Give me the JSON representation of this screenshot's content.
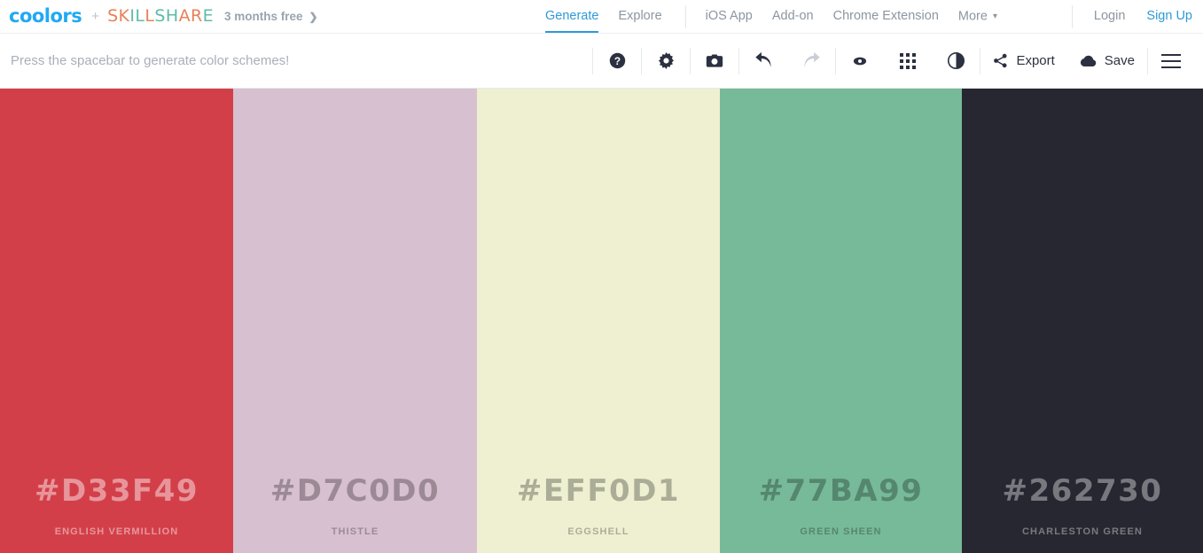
{
  "topnav": {
    "logo": "coolors",
    "plus": "+",
    "partner_logo": "SKILLSHARE",
    "partner_letters": [
      {
        "ch": "S",
        "color": "#E8815A"
      },
      {
        "ch": "K",
        "color": "#E8815A"
      },
      {
        "ch": "I",
        "color": "#5FBBA8"
      },
      {
        "ch": "L",
        "color": "#5FBBA8"
      },
      {
        "ch": "L",
        "color": "#E8815A"
      },
      {
        "ch": "S",
        "color": "#5FBBA8"
      },
      {
        "ch": "H",
        "color": "#5FBBA8"
      },
      {
        "ch": "A",
        "color": "#E8815A"
      },
      {
        "ch": "R",
        "color": "#E8815A"
      },
      {
        "ch": "E",
        "color": "#5FBBA8"
      }
    ],
    "promo": "3 months free",
    "promo_arrow": "❯",
    "center_items": [
      {
        "label": "Generate",
        "active": true
      },
      {
        "label": "Explore",
        "active": false
      }
    ],
    "secondary_items": [
      {
        "label": "iOS App"
      },
      {
        "label": "Add-on"
      },
      {
        "label": "Chrome Extension"
      },
      {
        "label": "More",
        "caret": "▾"
      }
    ],
    "account_items": [
      {
        "label": "Login",
        "accent": false
      },
      {
        "label": "Sign Up",
        "accent": true
      }
    ],
    "accent_color": "#2E9BD6",
    "logo_color": "#21A9F3"
  },
  "toolbar": {
    "hint": "Press the spacebar to generate color schemes!",
    "icons": [
      {
        "name": "help-icon",
        "title": "Help"
      },
      {
        "name": "gear-icon",
        "title": "Settings"
      },
      {
        "name": "camera-icon",
        "title": "Screenshot"
      },
      {
        "name": "undo-icon",
        "title": "Undo",
        "disabled": false
      },
      {
        "name": "redo-icon",
        "title": "Redo",
        "disabled": true
      },
      {
        "name": "eye-icon",
        "title": "View"
      },
      {
        "name": "grid-icon",
        "title": "Grid"
      },
      {
        "name": "contrast-icon",
        "title": "Adjust"
      }
    ],
    "export_label": "Export",
    "save_label": "Save",
    "menu_label": "Menu"
  },
  "palette": {
    "swatches": [
      {
        "hex": "#D33F49",
        "name": "ENGLISH VERMILLION",
        "text_color": "rgba(255,255,255,0.45)"
      },
      {
        "hex": "#D7C0D0",
        "name": "THISTLE",
        "text_color": "rgba(0,0,0,0.28)"
      },
      {
        "hex": "#EFF0D1",
        "name": "EGGSHELL",
        "text_color": "rgba(0,0,0,0.28)"
      },
      {
        "hex": "#77BA99",
        "name": "GREEN SHEEN",
        "text_color": "rgba(0,0,0,0.28)"
      },
      {
        "hex": "#262730",
        "name": "CHARLESTON GREEN",
        "text_color": "rgba(255,255,255,0.38)"
      }
    ]
  }
}
